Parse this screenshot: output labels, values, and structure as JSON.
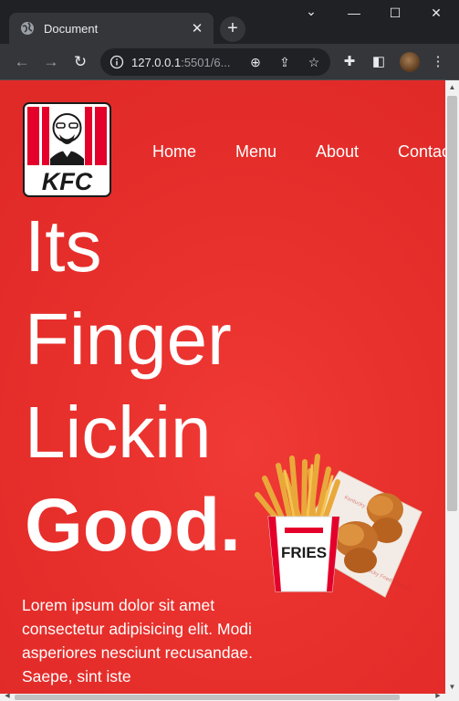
{
  "browser": {
    "tab_title": "Document",
    "tab_close": "✕",
    "new_tab": "+",
    "url_host": "127.0.0.1",
    "url_rest": ":5501/6...",
    "window": {
      "minimize": "—",
      "maximize": "☐",
      "close": "✕",
      "chevron": "⌄"
    }
  },
  "page": {
    "logo_text": "KFC",
    "nav": {
      "home": "Home",
      "menu": "Menu",
      "about": "About",
      "contact": "Contact"
    },
    "hero": {
      "line1": "Its",
      "line2": "Finger",
      "line3": "Lickin",
      "line4": "Good."
    },
    "description": "Lorem ipsum dolor sit amet consectetur adipisicing elit. Modi asperiores nesciunt recusandae. Saepe, sint iste",
    "fries_label": "FRIES"
  },
  "colors": {
    "brand_red": "#e8302c",
    "chrome_dark": "#202124",
    "chrome_tab": "#35363a"
  }
}
